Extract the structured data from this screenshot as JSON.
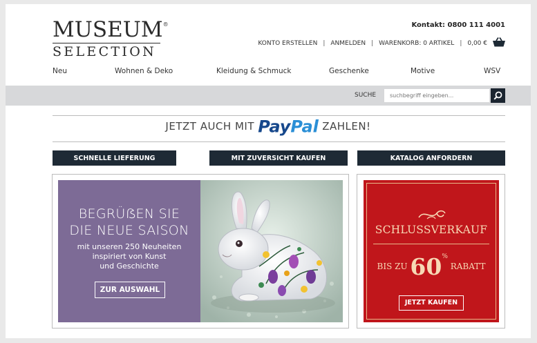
{
  "brand": {
    "logo_top": "MUSEUM",
    "logo_bottom": "SELECTION"
  },
  "header": {
    "contact": "Kontakt: 0800 111 4001",
    "create_account": "KONTO ERSTELLEN",
    "login": "ANMELDEN",
    "cart": "WARENKORB: 0 ARTIKEL",
    "cart_total": "0,00 €"
  },
  "nav": [
    "Neu",
    "Wohnen & Deko",
    "Kleidung & Schmuck",
    "Geschenke",
    "Motive",
    "WSV"
  ],
  "search": {
    "label": "SUCHE",
    "placeholder": "suchbegriff eingeben..."
  },
  "paypal": {
    "prefix": "JETZT AUCH MIT",
    "brand_a": "Pay",
    "brand_b": "Pal",
    "suffix": "ZAHLEN!"
  },
  "info_buttons": [
    "SCHNELLE LIEFERUNG",
    "MIT ZUVERSICHT KAUFEN",
    "KATALOG ANFORDERN"
  ],
  "promo": {
    "title_line1": "BEGRÜẞEN SIE",
    "title_line2": "DIE NEUE SAISON",
    "sub_line1": "mit unseren 250 Neuheiten",
    "sub_line2": "inspiriert von Kunst",
    "sub_line3": "und Geschichte",
    "button": "ZUR AUSWAHL"
  },
  "sale": {
    "title": "SCHLUSSVERKAUF",
    "bis_zu": "BIS ZU",
    "number": "60",
    "percent": "%",
    "rabatt": "RABATT",
    "button": "JETZT KAUFEN"
  },
  "colors": {
    "navy": "#1e2a35",
    "promo_purple": "#7d6b96",
    "sale_red": "#c0161b",
    "paypal_dark": "#17488c",
    "paypal_light": "#2b8fd6"
  }
}
